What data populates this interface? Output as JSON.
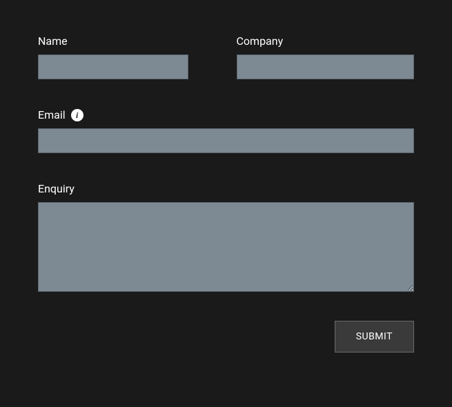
{
  "form": {
    "name": {
      "label": "Name",
      "value": ""
    },
    "company": {
      "label": "Company",
      "value": ""
    },
    "email": {
      "label": "Email",
      "value": "",
      "has_info": true
    },
    "enquiry": {
      "label": "Enquiry",
      "value": ""
    },
    "submit_label": "SUBMIT"
  }
}
